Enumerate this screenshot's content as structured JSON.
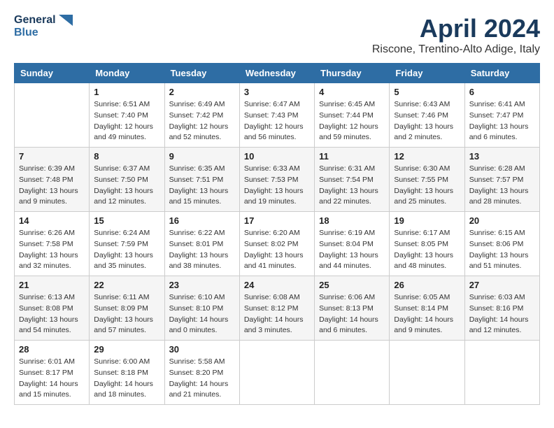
{
  "header": {
    "logo_line1": "General",
    "logo_line2": "Blue",
    "month": "April 2024",
    "location": "Riscone, Trentino-Alto Adige, Italy"
  },
  "days_of_week": [
    "Sunday",
    "Monday",
    "Tuesday",
    "Wednesday",
    "Thursday",
    "Friday",
    "Saturday"
  ],
  "weeks": [
    [
      {
        "day": "",
        "info": ""
      },
      {
        "day": "1",
        "info": "Sunrise: 6:51 AM\nSunset: 7:40 PM\nDaylight: 12 hours\nand 49 minutes."
      },
      {
        "day": "2",
        "info": "Sunrise: 6:49 AM\nSunset: 7:42 PM\nDaylight: 12 hours\nand 52 minutes."
      },
      {
        "day": "3",
        "info": "Sunrise: 6:47 AM\nSunset: 7:43 PM\nDaylight: 12 hours\nand 56 minutes."
      },
      {
        "day": "4",
        "info": "Sunrise: 6:45 AM\nSunset: 7:44 PM\nDaylight: 12 hours\nand 59 minutes."
      },
      {
        "day": "5",
        "info": "Sunrise: 6:43 AM\nSunset: 7:46 PM\nDaylight: 13 hours\nand 2 minutes."
      },
      {
        "day": "6",
        "info": "Sunrise: 6:41 AM\nSunset: 7:47 PM\nDaylight: 13 hours\nand 6 minutes."
      }
    ],
    [
      {
        "day": "7",
        "info": "Sunrise: 6:39 AM\nSunset: 7:48 PM\nDaylight: 13 hours\nand 9 minutes."
      },
      {
        "day": "8",
        "info": "Sunrise: 6:37 AM\nSunset: 7:50 PM\nDaylight: 13 hours\nand 12 minutes."
      },
      {
        "day": "9",
        "info": "Sunrise: 6:35 AM\nSunset: 7:51 PM\nDaylight: 13 hours\nand 15 minutes."
      },
      {
        "day": "10",
        "info": "Sunrise: 6:33 AM\nSunset: 7:53 PM\nDaylight: 13 hours\nand 19 minutes."
      },
      {
        "day": "11",
        "info": "Sunrise: 6:31 AM\nSunset: 7:54 PM\nDaylight: 13 hours\nand 22 minutes."
      },
      {
        "day": "12",
        "info": "Sunrise: 6:30 AM\nSunset: 7:55 PM\nDaylight: 13 hours\nand 25 minutes."
      },
      {
        "day": "13",
        "info": "Sunrise: 6:28 AM\nSunset: 7:57 PM\nDaylight: 13 hours\nand 28 minutes."
      }
    ],
    [
      {
        "day": "14",
        "info": "Sunrise: 6:26 AM\nSunset: 7:58 PM\nDaylight: 13 hours\nand 32 minutes."
      },
      {
        "day": "15",
        "info": "Sunrise: 6:24 AM\nSunset: 7:59 PM\nDaylight: 13 hours\nand 35 minutes."
      },
      {
        "day": "16",
        "info": "Sunrise: 6:22 AM\nSunset: 8:01 PM\nDaylight: 13 hours\nand 38 minutes."
      },
      {
        "day": "17",
        "info": "Sunrise: 6:20 AM\nSunset: 8:02 PM\nDaylight: 13 hours\nand 41 minutes."
      },
      {
        "day": "18",
        "info": "Sunrise: 6:19 AM\nSunset: 8:04 PM\nDaylight: 13 hours\nand 44 minutes."
      },
      {
        "day": "19",
        "info": "Sunrise: 6:17 AM\nSunset: 8:05 PM\nDaylight: 13 hours\nand 48 minutes."
      },
      {
        "day": "20",
        "info": "Sunrise: 6:15 AM\nSunset: 8:06 PM\nDaylight: 13 hours\nand 51 minutes."
      }
    ],
    [
      {
        "day": "21",
        "info": "Sunrise: 6:13 AM\nSunset: 8:08 PM\nDaylight: 13 hours\nand 54 minutes."
      },
      {
        "day": "22",
        "info": "Sunrise: 6:11 AM\nSunset: 8:09 PM\nDaylight: 13 hours\nand 57 minutes."
      },
      {
        "day": "23",
        "info": "Sunrise: 6:10 AM\nSunset: 8:10 PM\nDaylight: 14 hours\nand 0 minutes."
      },
      {
        "day": "24",
        "info": "Sunrise: 6:08 AM\nSunset: 8:12 PM\nDaylight: 14 hours\nand 3 minutes."
      },
      {
        "day": "25",
        "info": "Sunrise: 6:06 AM\nSunset: 8:13 PM\nDaylight: 14 hours\nand 6 minutes."
      },
      {
        "day": "26",
        "info": "Sunrise: 6:05 AM\nSunset: 8:14 PM\nDaylight: 14 hours\nand 9 minutes."
      },
      {
        "day": "27",
        "info": "Sunrise: 6:03 AM\nSunset: 8:16 PM\nDaylight: 14 hours\nand 12 minutes."
      }
    ],
    [
      {
        "day": "28",
        "info": "Sunrise: 6:01 AM\nSunset: 8:17 PM\nDaylight: 14 hours\nand 15 minutes."
      },
      {
        "day": "29",
        "info": "Sunrise: 6:00 AM\nSunset: 8:18 PM\nDaylight: 14 hours\nand 18 minutes."
      },
      {
        "day": "30",
        "info": "Sunrise: 5:58 AM\nSunset: 8:20 PM\nDaylight: 14 hours\nand 21 minutes."
      },
      {
        "day": "",
        "info": ""
      },
      {
        "day": "",
        "info": ""
      },
      {
        "day": "",
        "info": ""
      },
      {
        "day": "",
        "info": ""
      }
    ]
  ]
}
